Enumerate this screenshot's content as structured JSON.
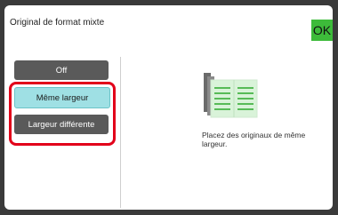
{
  "dialog": {
    "title": "Original de format mixte",
    "ok_label": "OK"
  },
  "options": [
    {
      "label": "Off",
      "selected": false
    },
    {
      "label": "Même largeur",
      "selected": true
    },
    {
      "label": "Largeur différente",
      "selected": false
    }
  ],
  "description": "Placez des originaux de même largeur.",
  "icons": {
    "documents": "same-width-documents-icon"
  },
  "colors": {
    "accent_ok": "#3dbb3a",
    "selected_option": "#9fe0e4",
    "highlight": "#e2001a"
  }
}
